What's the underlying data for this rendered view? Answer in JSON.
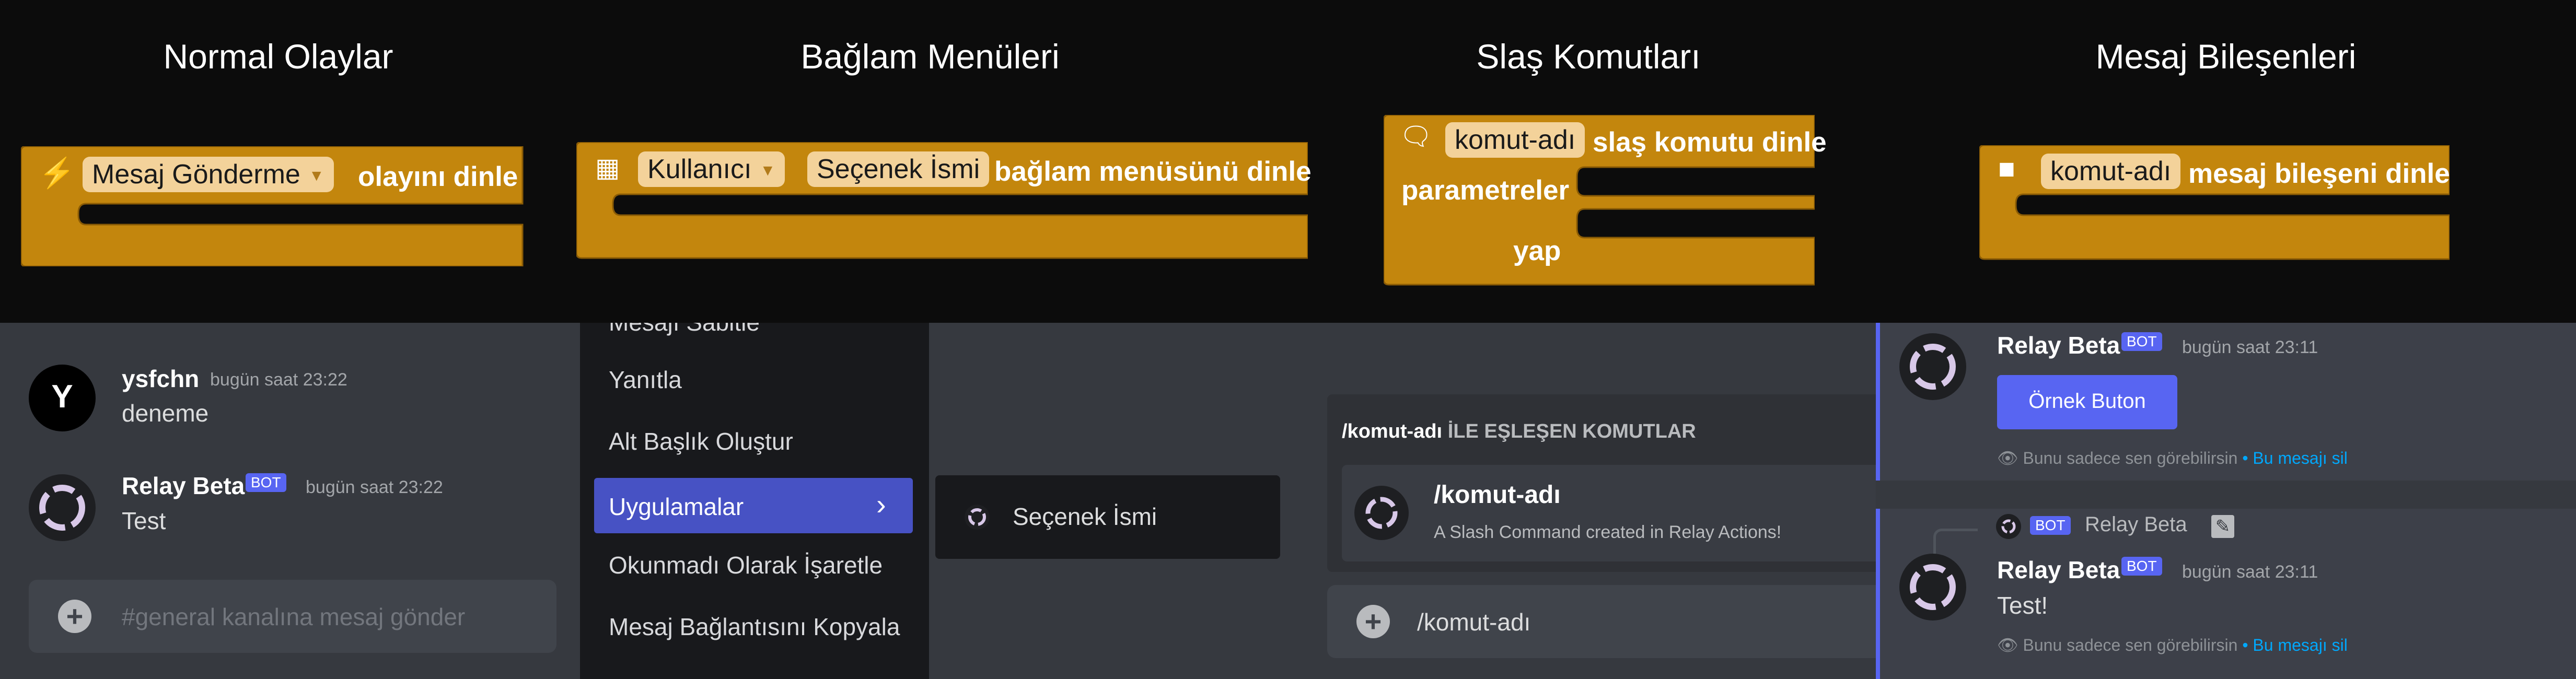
{
  "headings": [
    "Normal Olaylar",
    "Bağlam Menüleri",
    "Slaş Komutları",
    "Mesaj Bileşenleri"
  ],
  "blocks": {
    "event": {
      "dropdown": "Mesaj Gönderme",
      "suffix": "olayını dinle"
    },
    "context": {
      "type_dropdown": "Kullanıcı",
      "name_field": "Seçenek İsmi",
      "suffix": "bağlam menüsünü dinle"
    },
    "slash": {
      "name_field": "komut-adı",
      "suffix": "slaş komutu dinle",
      "params_label": "parametreler",
      "do_label": "yap"
    },
    "component": {
      "name_field": "komut-adı",
      "suffix": "mesaj bileşeni dinle"
    }
  },
  "chat1": {
    "messages": [
      {
        "user": "ysfchn",
        "avatar_letter": "Y",
        "time": "bugün saat 23:22",
        "text": "deneme"
      },
      {
        "user": "Relay Beta",
        "bot": "BOT",
        "time": "bugün saat 23:22",
        "text": "Test"
      }
    ],
    "input_placeholder": "#general kanalına mesaj gönder"
  },
  "context_menu": {
    "items": [
      "Mesajı Sabitle",
      "Yanıtla",
      "Alt Başlık Oluştur",
      "Uygulamalar",
      "Okunmadı Olarak İşaretle",
      "Mesaj Bağlantısını Kopyala"
    ],
    "submenu_item": "Seçenek İsmi"
  },
  "slash_panel": {
    "header_cmd": "/komut-adı",
    "header_rest": "İLE EŞLEŞEN KOMUTLAR",
    "cmd_name": "/komut-adı",
    "cmd_desc": "A Slash Command created in Relay Actions!",
    "input_text": "/komut-adı"
  },
  "components_panel": {
    "msg1": {
      "user": "Relay Beta",
      "bot": "BOT",
      "time": "bugün saat 23:11",
      "button": "Örnek Buton",
      "note": "Bunu sadece sen görebilirsin",
      "sep": "•",
      "note_link": "Bu mesajı sil"
    },
    "msg2": {
      "reply_user": "Relay Beta",
      "reply_bot": "BOT",
      "user": "Relay Beta",
      "bot": "BOT",
      "time": "bugün saat 23:11",
      "text": "Test!",
      "note": "Bunu sadece sen görebilirsin",
      "sep": "•",
      "note_link": "Bu mesajı sil"
    }
  },
  "colors": {
    "block": "#c3860d",
    "chip": "#f3d29a",
    "discord_bg": "#36393f",
    "accent": "#5865f2",
    "link": "#00a8fc"
  }
}
